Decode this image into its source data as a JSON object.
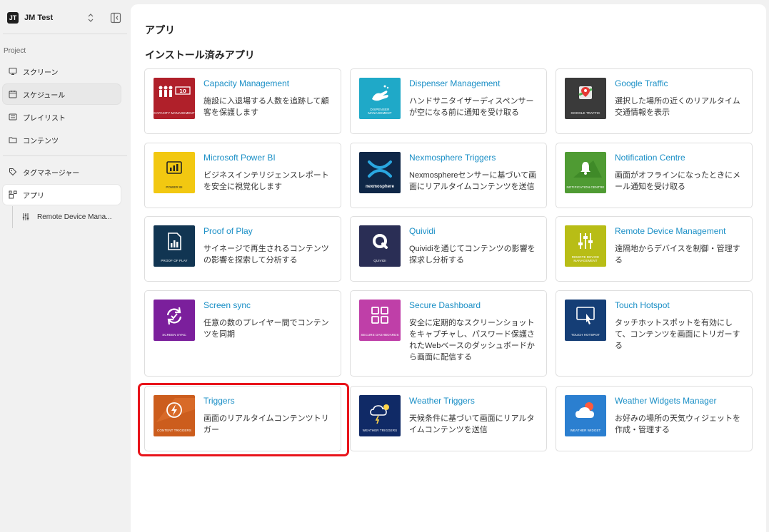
{
  "workspace": {
    "initials": "JT",
    "name": "JM Test"
  },
  "sidebar": {
    "section_label": "Project",
    "items": [
      {
        "label": "スクリーン",
        "icon": "monitor-icon"
      },
      {
        "label": "スケジュール",
        "icon": "calendar-icon"
      },
      {
        "label": "プレイリスト",
        "icon": "playlist-icon"
      },
      {
        "label": "コンテンツ",
        "icon": "folder-icon"
      },
      {
        "label": "タグマネージャー",
        "icon": "tag-icon"
      },
      {
        "label": "アプリ",
        "icon": "apps-icon"
      }
    ],
    "sub_item": {
      "label": "Remote Device Mana...",
      "icon": "sliders-icon"
    }
  },
  "main": {
    "page_title": "アプリ",
    "section_title": "インストール済みアプリ"
  },
  "apps": [
    {
      "title": "Capacity Management",
      "desc": "施設に入退場する人数を追跡して顧客を保護します",
      "caption": "CAPACITY MANAGEMENT",
      "color": "#b0202a",
      "icon": "people-count-icon"
    },
    {
      "title": "Dispenser Management",
      "desc": "ハンドサニタイザーディスペンサーが空になる前に通知を受け取る",
      "caption": "DISPENSER MANAGEMENT",
      "color": "#1fa9c8",
      "icon": "hand-wash-icon"
    },
    {
      "title": "Google Traffic",
      "desc": "選択した場所の近くのリアルタイム交通情報を表示",
      "caption": "GOOGLE TRAFFIC",
      "color": "#3a3a3a",
      "icon": "map-pin-icon"
    },
    {
      "title": "Microsoft Power BI",
      "desc": "ビジネスインテリジェンスレポートを安全に視覚化します",
      "caption": "POWER BI",
      "color": "#f2c811",
      "icon": "powerbi-icon"
    },
    {
      "title": "Nexmosphere Triggers",
      "desc": "Nexmosphereセンサーに基づいて画面にリアルタイムコンテンツを送信",
      "caption": "nexmosphere",
      "color": "#0f2747",
      "icon": "nexmosphere-icon"
    },
    {
      "title": "Notification Centre",
      "desc": "画面がオフラインになったときにメール通知を受け取る",
      "caption": "NOTIFICATION CENTRE",
      "color": "#4f9b33",
      "icon": "bell-icon"
    },
    {
      "title": "Proof of Play",
      "desc": "サイネージで再生されるコンテンツの影響を探索して分析する",
      "caption": "PROOF OF PLAY",
      "color": "#113552",
      "icon": "report-icon"
    },
    {
      "title": "Quividi",
      "desc": "Quividiを通じてコンテンツの影響を探求し分析する",
      "caption": "QUIVIDI",
      "color": "#2a2e55",
      "icon": "quividi-icon"
    },
    {
      "title": "Remote Device Management",
      "desc": "遠隔地からデバイスを制御・管理する",
      "caption": "REMOTE DEVICE MANAGEMENT",
      "color": "#b8bd16",
      "icon": "sliders-icon"
    },
    {
      "title": "Screen sync",
      "desc": "任意の数のプレイヤー間でコンテンツを同期",
      "caption": "SCREEN SYNC",
      "color": "#7b1f9c",
      "icon": "sync-icon"
    },
    {
      "title": "Secure Dashboard",
      "desc": "安全に定期的なスクリーンショットをキャプチャし、パスワード保護されたWebベースのダッシュボードから画面に配信する",
      "caption": "SECURE DASHBOARDS",
      "color": "#bf3fa8",
      "icon": "dashboard-icon"
    },
    {
      "title": "Touch Hotspot",
      "desc": "タッチホットスポットを有効にして、コンテンツを画面にトリガーする",
      "caption": "TOUCH HOTSPOT",
      "color": "#153e76",
      "icon": "touch-icon"
    },
    {
      "title": "Triggers",
      "desc": "画面のリアルタイムコンテンツトリガー",
      "caption": "CONTENT TRIGGERS",
      "color": "#cc5d1d",
      "icon": "lightning-icon"
    },
    {
      "title": "Weather Triggers",
      "desc": "天候条件に基づいて画面にリアルタイムコンテンツを送信",
      "caption": "WEATHER TRIGGERS",
      "color": "#102a66",
      "icon": "storm-icon"
    },
    {
      "title": "Weather Widgets Manager",
      "desc": "お好みの場所の天気ウィジェットを作成・管理する",
      "caption": "WEATHER WIDGET",
      "color": "#2b7fd0",
      "icon": "cloud-icon"
    }
  ]
}
